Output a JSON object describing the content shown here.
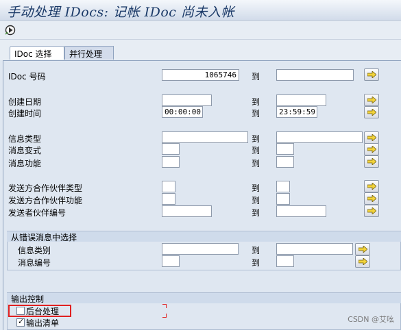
{
  "window": {
    "title": "手动处理 IDocs: 记帐 IDoc 尚未入帐"
  },
  "toolbar": {
    "execute_icon": "execute-icon"
  },
  "tabs": [
    {
      "label": "IDoc 选择"
    },
    {
      "label": "并行处理"
    }
  ],
  "to_label": "到",
  "rows": {
    "idoc_number": {
      "label": "IDoc 号码",
      "from": "1065746",
      "to": ""
    },
    "created_date": {
      "label": "创建日期",
      "from": "",
      "to": ""
    },
    "created_time": {
      "label": "创建时间",
      "from": "00:00:00",
      "to": "23:59:59"
    },
    "message_type": {
      "label": "信息类型",
      "from": "",
      "to": ""
    },
    "message_variant": {
      "label": "消息变式",
      "from": "",
      "to": ""
    },
    "message_function": {
      "label": "消息功能",
      "from": "",
      "to": ""
    },
    "partner_type": {
      "label": "发送方合作伙伴类型",
      "from": "",
      "to": ""
    },
    "partner_function": {
      "label": "发送方合作伙伴功能",
      "from": "",
      "to": ""
    },
    "partner_number": {
      "label": "发送者伙伴编号",
      "from": "",
      "to": ""
    }
  },
  "error_group": {
    "title": "从错误消息中选择",
    "msg_class": {
      "label": "信息类别",
      "from": "",
      "to": ""
    },
    "msg_number": {
      "label": "消息编号",
      "from": "",
      "to": ""
    }
  },
  "output_group": {
    "title": "输出控制",
    "background": {
      "label": "后台处理",
      "checked": false
    },
    "output_list": {
      "label": "输出清单",
      "checked": true
    }
  },
  "watermark": "CSDN @艾吆"
}
